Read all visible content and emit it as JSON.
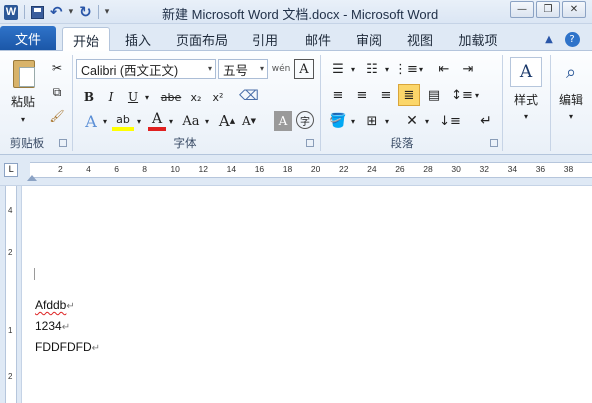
{
  "window": {
    "title": "新建 Microsoft Word 文档.docx - Microsoft Word"
  },
  "qat": {
    "logo": "W",
    "dropdown": "▾"
  },
  "tabs": {
    "file": "文件",
    "items": [
      "开始",
      "插入",
      "页面布局",
      "引用",
      "邮件",
      "审阅",
      "视图",
      "加载项"
    ]
  },
  "clipboard": {
    "paste_label": "粘贴",
    "group_label": "剪贴板"
  },
  "font": {
    "name": "Calibri (西文正文)",
    "size": "五号",
    "group_label": "字体",
    "bold": "B",
    "italic": "I",
    "underline": "U",
    "strike": "abe",
    "subscript": "x₂",
    "superscript": "x²",
    "grow": "A",
    "shrink": "A",
    "change_case": "Aa",
    "phonetic": "wén",
    "border_char": "A",
    "highlight": "ab",
    "font_color": "A",
    "shading": "A",
    "enclose": "字"
  },
  "paragraph": {
    "group_label": "段落"
  },
  "styles": {
    "label": "样式"
  },
  "editing": {
    "label": "编辑"
  },
  "ruler": {
    "numbers": [
      "2",
      "4",
      "6",
      "8",
      "10",
      "12",
      "14",
      "16",
      "18",
      "20",
      "22",
      "24",
      "26",
      "28",
      "30",
      "32",
      "34",
      "36",
      "38"
    ],
    "vnumbers": [
      "4",
      "2",
      "1",
      "2"
    ]
  },
  "document": {
    "lines": [
      "Afddb",
      "1234",
      "FDDFDFD"
    ],
    "para_mark": "↵"
  },
  "colors": {
    "file_tab": "#1b57a8",
    "ribbon_bg": "#e9f0f8",
    "accent": "#2b5797"
  }
}
